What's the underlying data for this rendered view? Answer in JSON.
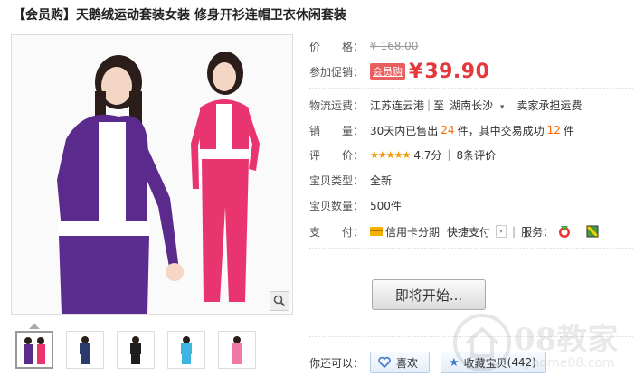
{
  "product": {
    "title": "【会员购】天鹅绒运动套装女装 修身开衫连帽卫衣休闲套装"
  },
  "info": {
    "price_label": "价　　格：",
    "original_price": "¥ 168.00",
    "promo_label": "参加促销：",
    "promo_badge": "会员购",
    "promo_currency": "¥",
    "promo_price": "39.90",
    "shipping_label": "物流运费：",
    "ship_from": "江苏连云港",
    "ship_to_prefix": "至",
    "ship_to": "湖南长沙",
    "ship_note": "卖家承担运费",
    "sales_label": "销　　量：",
    "sales_prefix": "30天内已售出",
    "sales_count": "24",
    "sales_mid": "件，其中交易成功",
    "sales_success": "12",
    "sales_suffix": "件",
    "rating_label": "评　　价：",
    "rating_stars": "★★★★★",
    "rating_score": "4.7分",
    "rating_reviews": "8条评价",
    "type_label": "宝贝类型：",
    "type_value": "全新",
    "qty_label": "宝贝数量：",
    "qty_value": "500件",
    "pay_label": "支　　付：",
    "pay_credit": "信用卡分期",
    "pay_quick": "快捷支付",
    "service_label": "服务："
  },
  "actions": {
    "start_button": "即将开始...",
    "also_label": "你还可以：",
    "like_button": "喜欢",
    "fav_button": "收藏宝贝",
    "fav_count": "(442)"
  },
  "watermark": {
    "text": "08教家",
    "url": "ityhome08.com"
  },
  "colors": {
    "price_red": "#e4393c",
    "highlight_orange": "#ff6600",
    "outfit_purple": "#5a2a8c",
    "outfit_pink": "#e8356f"
  }
}
